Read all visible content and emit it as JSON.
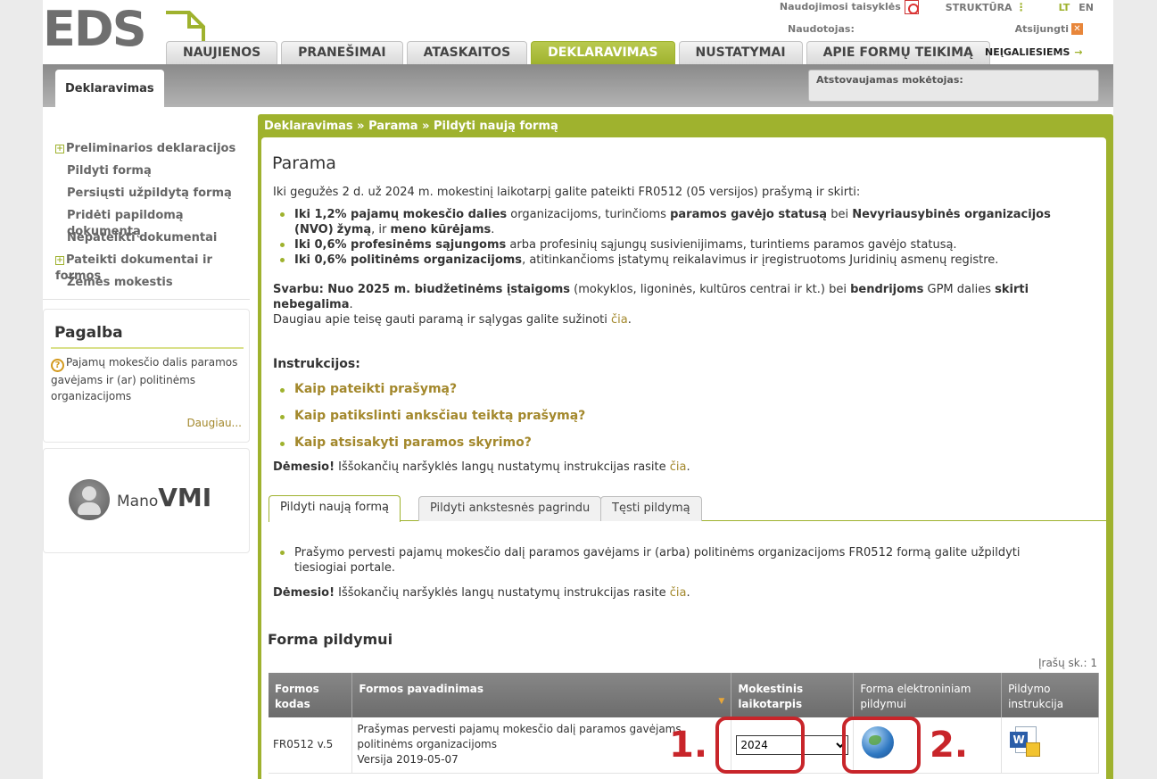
{
  "header": {
    "logo_text": "EDS",
    "rules_link": "Naudojimosi taisyklės",
    "structure_link": "STRUKTŪRA",
    "lang_lt": "LT",
    "lang_en": "EN",
    "user_label": "Naudotojas:",
    "logout": "Atsijungti",
    "accessibility": "NEĮGALIESIEMS",
    "tabs": [
      {
        "label": "NAUJIENOS"
      },
      {
        "label": "PRANEŠIMAI"
      },
      {
        "label": "ATASKAITOS"
      },
      {
        "label": "DEKLARAVIMAS"
      },
      {
        "label": "NUSTATYMAI"
      },
      {
        "label": "APIE FORMŲ TEIKIMĄ"
      }
    ],
    "active_tab": "DEKLARAVIMAS"
  },
  "subbar": {
    "section_tab": "Deklaravimas",
    "payer_label": "Atstovaujamas mokėtojas:"
  },
  "sidebar": {
    "items": [
      {
        "label": "Preliminarios deklaracijos",
        "expandable": true
      },
      {
        "label": "Pildyti formą",
        "expandable": false
      },
      {
        "label": "Persiųsti užpildytą formą",
        "expandable": false
      },
      {
        "label": "Pridėti papildomą dokumentą",
        "expandable": false
      },
      {
        "label": "Nepateikti dokumentai",
        "expandable": false
      },
      {
        "label": "Pateikti dokumentai ir formos",
        "expandable": true
      },
      {
        "label": "Žemės mokestis",
        "expandable": false
      }
    ],
    "help": {
      "title": "Pagalba",
      "text": "Pajamų mokesčio dalis paramos gavėjams ir (ar) politinėms organizacijoms",
      "more": "Daugiau..."
    },
    "mano_vmi": {
      "mano": "Mano",
      "vmi": "VMI"
    }
  },
  "main": {
    "breadcrumb": "Deklaravimas » Parama » Pildyti naują formą",
    "title": "Parama",
    "intro": "Iki gegužės 2 d. už 2024 m. mokestinį laikotarpį galite pateikti FR0512 (05 versijos) prašymą ir skirti:",
    "bullets": [
      {
        "bold1": "Iki 1,2% pajamų mokesčio dalies",
        "t1": " organizacijoms, turinčioms ",
        "bold2": "paramos gavėjo statusą",
        "t2": " bei ",
        "bold3": "Nevyriausybinės organizacijos (NVO)",
        "t3": " ",
        "bold4": "žymą",
        "t4": ", ir ",
        "bold5": "meno kūrėjams",
        "t5": "."
      },
      {
        "bold1": "Iki 0,6% profesinėms sąjungoms",
        "t1": " arba profesinių sąjungų susivienijimams, turintiems paramos gavėjo statusą."
      },
      {
        "bold1": "Iki 0,6% politinėms organizacijoms",
        "t1": ", atitinkančioms įstatymų reikalavimus ir įregistruotoms Juridinių asmenų registre."
      }
    ],
    "important": {
      "bold1": "Svarbu: Nuo 2025 m. biudžetinėms įstaigoms",
      "t1": " (mokyklos, ligoninės, kultūros centrai ir kt.) bei ",
      "bold2": "bendrijoms",
      "t2": " GPM dalies ",
      "bold3": "skirti nebegalima",
      "t3": ".",
      "more_text": "Daugiau apie teisę gauti paramą ir sąlygas galite sužinoti ",
      "more_link": "čia",
      "more_end": "."
    },
    "instructions_title": "Instrukcijos:",
    "instructions": [
      {
        "label": "Kaip pateikti prašymą?"
      },
      {
        "label": "Kaip patikslinti anksčiau teiktą prašymą?"
      },
      {
        "label": "Kaip atsisakyti paramos skyrimo?"
      }
    ],
    "attention": {
      "bold": "Dėmesio!",
      "text": " Iššokančių naršyklės langų nustatymų instrukcijas rasite ",
      "link": "čia",
      "end": "."
    },
    "form_tabs": [
      {
        "label": "Pildyti naują formą"
      },
      {
        "label": "Pildyti ankstesnės pagrindu"
      },
      {
        "label": "Tęsti pildymą"
      }
    ],
    "form_info": "Prašymo pervesti pajamų mokesčio dalį paramos gavėjams ir (arba) politinėms organizacijoms FR0512 formą galite užpildyti tiesiogiai portale.",
    "form_section_title": "Forma pildymui",
    "record_count": "Įrašų sk.: 1",
    "table": {
      "headers": [
        "Formos kodas",
        "Formos pavadinimas",
        "Mokestinis laikotarpis",
        "Forma elektroniniam pildymui",
        "Pildymo instrukcija"
      ],
      "rows": [
        {
          "code": "FR0512 v.5",
          "name_line1": "Prašymas pervesti pajamų mokesčio dalį paramos gavėjams",
          "name_line2": "politinėms organizacijoms",
          "version": "Versija 2019-05-07",
          "period": "2024"
        }
      ]
    }
  },
  "annotations": {
    "mark1": "1.",
    "mark2": "2.",
    "color": "#c8252a"
  },
  "colors": {
    "accent": "#9fb22e",
    "link": "#a3882c",
    "header_grey": "#878787"
  }
}
